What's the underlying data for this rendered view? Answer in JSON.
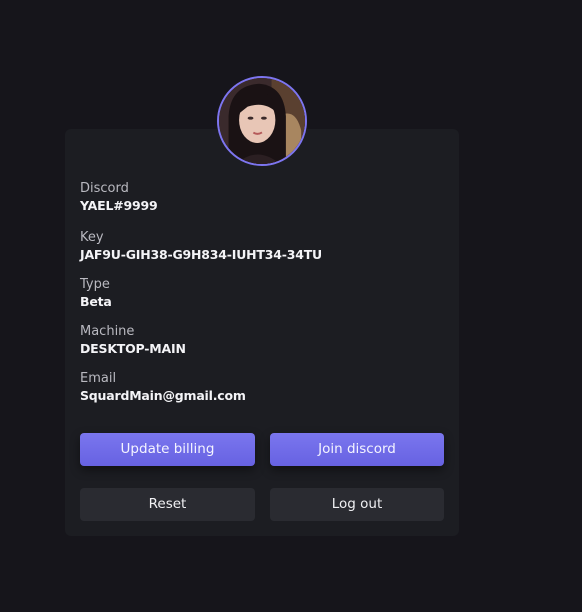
{
  "profile": {
    "avatar": {
      "icon": "user-avatar-photo",
      "border_color": "#7d75f0"
    },
    "fields": [
      {
        "label": "Discord",
        "value": "YAEL#9999"
      },
      {
        "label": "Key",
        "value": "JAF9U-GIH38-G9H834-IUHT34-34TU"
      },
      {
        "label": "Type",
        "value": "Beta"
      },
      {
        "label": "Machine",
        "value": "DESKTOP-MAIN"
      },
      {
        "label": "Email",
        "value": "SquardMain@gmail.com"
      }
    ]
  },
  "actions": {
    "update_billing": "Update billing",
    "join_discord": "Join discord",
    "reset": "Reset",
    "log_out": "Log out"
  },
  "colors": {
    "background": "#16151b",
    "card": "#1c1d22",
    "accent": "#6f6ae8",
    "secondary_button": "#2a2b31"
  }
}
